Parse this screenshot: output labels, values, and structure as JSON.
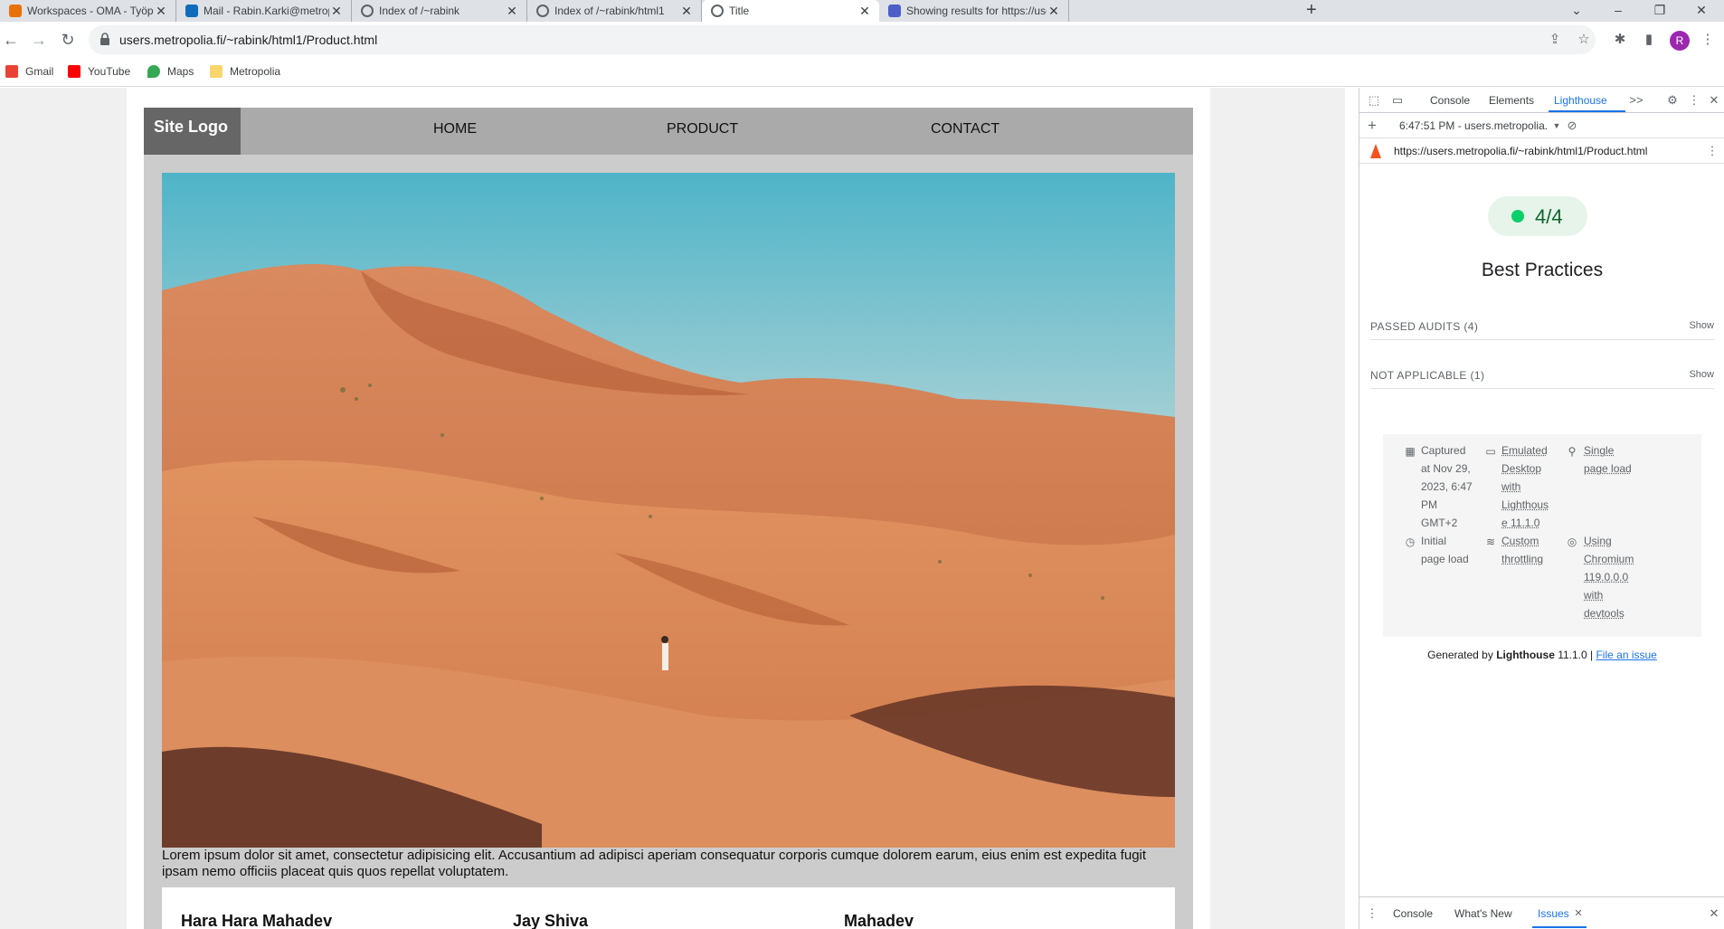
{
  "browser": {
    "tabs": [
      {
        "title": "Workspaces - OMA - Työpöytä",
        "icon": "oma-icon",
        "color": "#e8710a"
      },
      {
        "title": "Mail - Rabin.Karki@metropolia.fi",
        "icon": "outlook-icon",
        "color": "#0f6cbd"
      },
      {
        "title": "Index of /~rabink",
        "icon": "globe-icon",
        "color": "#5f6368"
      },
      {
        "title": "Index of /~rabink/html1",
        "icon": "globe-icon",
        "color": "#5f6368"
      },
      {
        "title": "Title",
        "icon": "globe-icon",
        "color": "#5f6368"
      },
      {
        "title": "Showing results for https://users",
        "icon": "wave-icon",
        "color": "#4b5fc7"
      }
    ],
    "active_tab": 4,
    "close_glyph": "✕",
    "new_tab_glyph": "+",
    "url": "users.metropolia.fi/~rabink/html1/Product.html",
    "avatar_letter": "R",
    "bookmarks": [
      {
        "label": "Gmail",
        "color": "#ea4335"
      },
      {
        "label": "YouTube",
        "color": "#ff0000"
      },
      {
        "label": "Maps",
        "color": "#34a853"
      },
      {
        "label": "Metropolia",
        "color": "#f9d56e"
      }
    ]
  },
  "page": {
    "logo": "Site Logo",
    "nav": [
      "HOME",
      "PRODUCT",
      "CONTACT"
    ],
    "lorem": "Lorem ipsum dolor sit amet, consectetur adipisicing elit. Accusantium ad adipisci aperiam consequatur corporis cumque dolorem earum, eius enim est expedita fugit ipsam nemo officiis placeat quis quos repellat voluptatem.",
    "cards": [
      "Hara Hara Mahadev",
      "Jay Shiva",
      "Mahadev"
    ]
  },
  "devtools": {
    "tabs": [
      "Console",
      "Elements",
      "Lighthouse"
    ],
    "active_tab": "Lighthouse",
    "more_glyph": ">>",
    "report_selector": "6:47:51 PM - users.metropolia.",
    "report_url": "https://users.metropolia.fi/~rabink/html1/Product.html",
    "score": "4/4",
    "score_color": "#0cce6b",
    "category": "Best Practices",
    "groups": [
      {
        "label": "PASSED AUDITS (4)",
        "action": "Show"
      },
      {
        "label": "NOT APPLICABLE (1)",
        "action": "Show"
      }
    ],
    "env": {
      "captured": [
        "Captured",
        "at Nov 29,",
        "2023, 6:47",
        "PM",
        "GMT+2"
      ],
      "emulated": [
        "Emulated",
        "Desktop",
        "with",
        "Lighthous",
        "e 11.1.0"
      ],
      "single": [
        "Single",
        "page load"
      ],
      "initial": [
        "Initial",
        "page load"
      ],
      "throttling": [
        "Custom",
        "throttling"
      ],
      "chromium": [
        "Using",
        "Chromium",
        "119.0.0.0",
        "with",
        "devtools"
      ]
    },
    "footer": {
      "prefix": "Generated by ",
      "brand": "Lighthouse",
      "version": " 11.1.0 | ",
      "link": "File an issue"
    },
    "drawer_tabs": [
      "Console",
      "What's New",
      "Issues"
    ],
    "drawer_active": "Issues"
  }
}
